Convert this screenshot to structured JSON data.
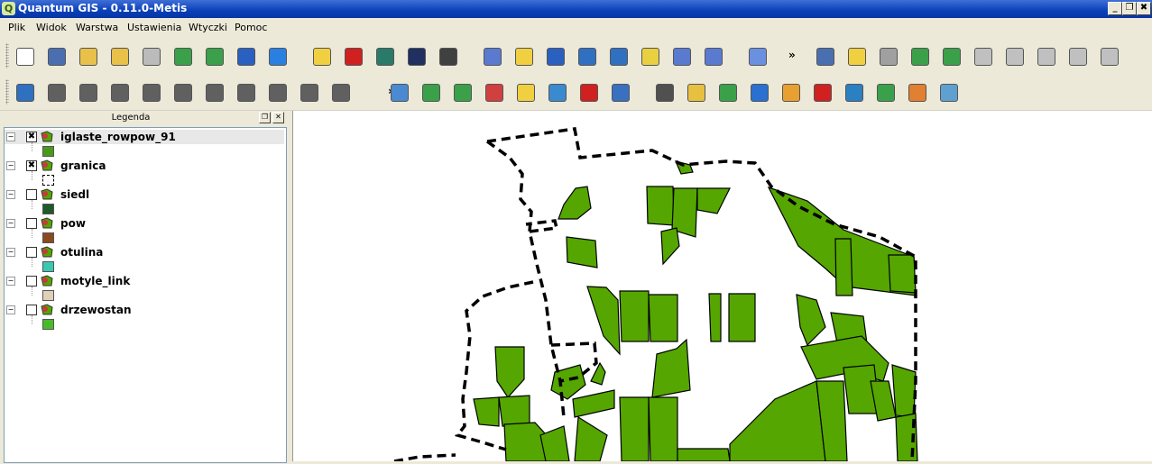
{
  "window": {
    "title": "Quantum GIS - 0.11.0-Metis",
    "app_icon": "Q",
    "controls": [
      "_",
      "❐",
      "✖"
    ]
  },
  "menubar": [
    "Plik",
    "Widok",
    "Warstwa",
    "Ustawienia",
    "Wtyczki",
    "Pomoc"
  ],
  "toolbar1": [
    {
      "name": "new-project-icon",
      "color": "#ffffff"
    },
    {
      "name": "save-project-icon",
      "color": "#4a6fb0"
    },
    {
      "name": "save-as-icon",
      "color": "#e8c04a"
    },
    {
      "name": "open-project-icon",
      "color": "#e8c04a"
    },
    {
      "name": "print-icon",
      "color": "#bbbbbb"
    },
    {
      "name": "add-vector-layer-icon",
      "color": "#3aa04a"
    },
    {
      "name": "add-raster-layer-icon",
      "color": "#3aa04a"
    },
    {
      "name": "add-postgis-layer-icon",
      "color": "#2a60c0"
    },
    {
      "name": "add-wms-layer-icon",
      "color": "#2a80e0"
    },
    {
      "name": "new-layer-icon",
      "color": "#f0d040"
    },
    {
      "name": "remove-layer-icon",
      "color": "#d02020"
    },
    {
      "name": "overview-icon",
      "color": "#2a7a6a"
    },
    {
      "name": "show-all-icon",
      "color": "#203060"
    },
    {
      "name": "hide-all-icon",
      "color": "#404040"
    },
    {
      "name": "identify-icon",
      "color": "#5a7ad0"
    },
    {
      "name": "select-icon",
      "color": "#f0d040"
    },
    {
      "name": "attribute-table-icon",
      "color": "#2a60c0"
    },
    {
      "name": "measure-line-icon",
      "color": "#3070c0"
    },
    {
      "name": "measure-area-icon",
      "color": "#3070c0"
    },
    {
      "name": "map-tips-icon",
      "color": "#e8d040"
    },
    {
      "name": "home-icon",
      "color": "#5a7ad0"
    },
    {
      "name": "gps-home-icon",
      "color": "#5a7ad0"
    },
    {
      "name": "help-icon",
      "color": "#6a90e0"
    },
    {
      "name": "plugin-1-icon",
      "color": "#4a6fb0"
    },
    {
      "name": "plugin-2-icon",
      "color": "#f0d040"
    },
    {
      "name": "plugin-3-icon",
      "color": "#a0a0a0"
    },
    {
      "name": "plugin-4-icon",
      "color": "#3aa04a"
    },
    {
      "name": "plugin-5-icon",
      "color": "#3aa04a"
    },
    {
      "name": "plugin-6-icon",
      "color": "#c0c0c0"
    },
    {
      "name": "plugin-7-icon",
      "color": "#c0c0c0"
    },
    {
      "name": "plugin-8-icon",
      "color": "#c0c0c0"
    },
    {
      "name": "plugin-9-icon",
      "color": "#c0c0c0"
    },
    {
      "name": "plugin-10-icon",
      "color": "#c0c0c0"
    }
  ],
  "toolbar1_overflow": "»",
  "toolbar2": [
    {
      "name": "toggle-editing-icon",
      "color": "#3070c0"
    },
    {
      "name": "capture-point-icon",
      "color": "#606060"
    },
    {
      "name": "capture-line-icon",
      "color": "#606060"
    },
    {
      "name": "capture-polygon-icon",
      "color": "#606060"
    },
    {
      "name": "add-ring-icon",
      "color": "#606060"
    },
    {
      "name": "add-island-icon",
      "color": "#606060"
    },
    {
      "name": "split-features-icon",
      "color": "#606060"
    },
    {
      "name": "move-vertex-icon",
      "color": "#606060"
    },
    {
      "name": "add-vertex-icon",
      "color": "#606060"
    },
    {
      "name": "delete-vertex-icon",
      "color": "#606060"
    },
    {
      "name": "delete-selected-icon",
      "color": "#606060"
    },
    {
      "name": "pan-icon",
      "color": "#4a8ad0"
    },
    {
      "name": "zoom-in-icon",
      "color": "#3aa04a"
    },
    {
      "name": "zoom-out-icon",
      "color": "#3aa04a"
    },
    {
      "name": "zoom-full-icon",
      "color": "#d04040"
    },
    {
      "name": "zoom-selection-icon",
      "color": "#f0d040"
    },
    {
      "name": "zoom-layer-icon",
      "color": "#3a8ad0"
    },
    {
      "name": "zoom-last-icon",
      "color": "#d02020"
    },
    {
      "name": "refresh-icon",
      "color": "#3a70c0"
    },
    {
      "name": "copyright-icon",
      "color": "#505050"
    },
    {
      "name": "north-arrow-icon",
      "color": "#e8c040"
    },
    {
      "name": "scale-bar-icon",
      "color": "#3aa04a"
    },
    {
      "name": "georeferencer-icon",
      "color": "#2a70d0"
    },
    {
      "name": "navigation-icon",
      "color": "#e8a030"
    },
    {
      "name": "pdf-export-icon",
      "color": "#d02020"
    },
    {
      "name": "delimited-text-icon",
      "color": "#2a80c0"
    },
    {
      "name": "grid-maker-icon",
      "color": "#3aa04a"
    },
    {
      "name": "spit-icon",
      "color": "#e08030"
    },
    {
      "name": "quick-print-icon",
      "color": "#60a0d0"
    }
  ],
  "toolbar2_overflow": "»",
  "legend": {
    "title": "Legenda",
    "layers": [
      {
        "name": "iglaste_rowpow_91",
        "checked": true,
        "swatch": "#4a9a1a",
        "symbol": "polygon",
        "selected": true
      },
      {
        "name": "granica",
        "checked": true,
        "swatch": "#ffffff",
        "symbol": "dashed-outline",
        "selected": false
      },
      {
        "name": "siedl",
        "checked": false,
        "swatch": "#1f5a2a",
        "symbol": "polygon",
        "selected": false
      },
      {
        "name": "pow",
        "checked": false,
        "swatch": "#8a4a20",
        "symbol": "polygon",
        "selected": false
      },
      {
        "name": "otulina",
        "checked": false,
        "swatch": "#3ac8b0",
        "symbol": "polygon",
        "selected": false
      },
      {
        "name": "motyle_link",
        "checked": false,
        "swatch": "#e0d0b8",
        "symbol": "polygon",
        "selected": false
      },
      {
        "name": "drzewostan",
        "checked": false,
        "swatch": "#4aba2a",
        "symbol": "polygon",
        "selected": false
      }
    ]
  },
  "map": {
    "feature_fill": "#55a600",
    "feature_stroke": "#000000",
    "boundary_stroke": "#000000"
  }
}
